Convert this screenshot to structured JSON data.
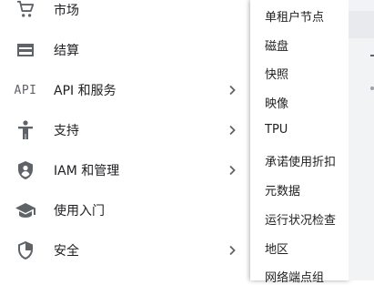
{
  "nav": {
    "items": [
      {
        "label": "市场",
        "icon": "cart-icon",
        "has_submenu": false
      },
      {
        "label": "结算",
        "icon": "billing-icon",
        "has_submenu": false
      },
      {
        "label": "API 和服务",
        "icon": "api-icon",
        "icon_text": "API",
        "has_submenu": true
      },
      {
        "label": "支持",
        "icon": "support-icon",
        "has_submenu": true
      },
      {
        "label": "IAM 和管理",
        "icon": "iam-shield-icon",
        "has_submenu": true
      },
      {
        "label": "使用入门",
        "icon": "graduation-cap-icon",
        "has_submenu": false
      },
      {
        "label": "安全",
        "icon": "security-shield-icon",
        "has_submenu": true
      }
    ]
  },
  "submenu": {
    "items": [
      "单租户节点",
      "磁盘",
      "快照",
      "映像",
      "TPU",
      "承诺使用折扣",
      "元数据",
      "运行状况检查",
      "地区",
      "网络端点组"
    ]
  },
  "colors": {
    "icon": "#5f6368",
    "text": "#202124",
    "background_right": "#f1f3f4"
  }
}
